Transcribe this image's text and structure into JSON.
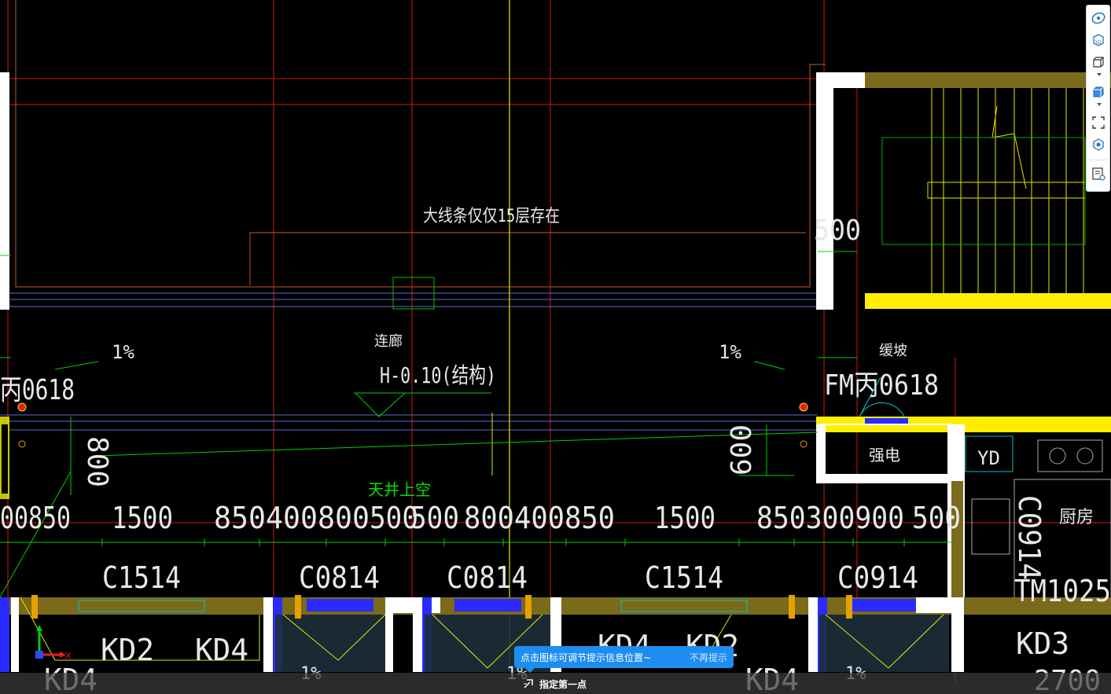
{
  "drawing": {
    "note_floor": "大线条仅仅15层存在",
    "label_corridor": "连廊",
    "elevation": "H-0.10(结构)",
    "slope_left": "1%",
    "slope_right": "1%",
    "slope_bottom_left": "1%",
    "slope_bottom_mid": "1%",
    "slope_bottom_right": "1%",
    "door_left": "丙0618",
    "door_right": "FM丙0618",
    "ramp": "缓坡",
    "shaft": "天井上空",
    "room_power": "强电",
    "room_yd": "YD",
    "room_kitchen": "厨房",
    "dim_600": "600",
    "dim_800": "800",
    "dim_500": "500",
    "dim_2700": "2700",
    "dims": [
      "00850",
      "1500",
      "850400800",
      "500",
      "500",
      "800400850",
      "1500",
      "850300900",
      "500"
    ],
    "windows": [
      "C1514",
      "C0814",
      "C0814",
      "C1514",
      "C0914"
    ],
    "win_c0914_v": "C0914",
    "door_tm": "TM1025",
    "kd": [
      "KD2",
      "KD4",
      "KD4",
      "KD4",
      "KD2",
      "KD4",
      "KD3"
    ],
    "colors": {
      "background": "#000000",
      "axis": "#e11d1d",
      "dimension": "#00d000",
      "wall_fill": "#ffffff",
      "yellow": "#e6e600",
      "blue_window": "#2b2bff",
      "cyan": "#00d0d0",
      "text": "#e6e6e6"
    }
  },
  "toolbar": {
    "items": [
      {
        "icon": "orbit-icon",
        "title": "动态观察"
      },
      {
        "icon": "view-3d-icon",
        "title": "3D"
      },
      {
        "icon": "cube-wire-icon",
        "title": "视图"
      },
      {
        "icon": "cube-solid-icon",
        "title": "显示样式"
      },
      {
        "icon": "fullscreen-icon",
        "title": "全屏"
      },
      {
        "icon": "component-icon",
        "title": "构件"
      },
      {
        "icon": "info-list-icon",
        "title": "提示信息"
      }
    ]
  },
  "tip": {
    "message": "点击图标可调节提示信息位置~",
    "dismiss": "不再提示"
  },
  "command": {
    "prompt": "指定第一点"
  },
  "ucs": {
    "x_label": "X",
    "y_label": "Y"
  }
}
